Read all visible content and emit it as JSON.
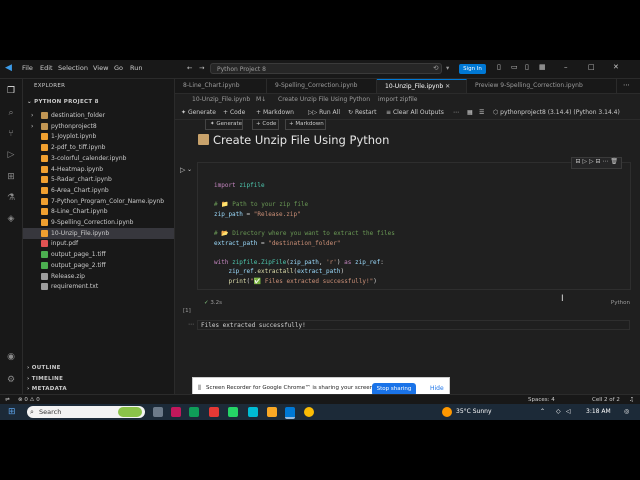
{
  "menu": [
    "File",
    "Edit",
    "Selection",
    "View",
    "Go",
    "Run"
  ],
  "title_search": "Python Project 8",
  "sign_in": "Sign In",
  "explorer": {
    "title": "EXPLORER",
    "project": "PYTHON PROJECT 8",
    "items": [
      {
        "label": "destination_folder",
        "kind": "folder"
      },
      {
        "label": "pythonproject8",
        "kind": "folder"
      },
      {
        "label": "1-Joyplot.ipynb",
        "kind": "nb"
      },
      {
        "label": "2-pdf_to_tiff.ipynb",
        "kind": "nb"
      },
      {
        "label": "3-colorful_calender.ipynb",
        "kind": "nb"
      },
      {
        "label": "4-Heatmap.ipynb",
        "kind": "nb"
      },
      {
        "label": "5-Radar_chart.ipynb",
        "kind": "nb"
      },
      {
        "label": "6-Area_Chart.ipynb",
        "kind": "nb"
      },
      {
        "label": "7-Python_Program_Color_Name.ipynb",
        "kind": "nb"
      },
      {
        "label": "8-Line_Chart.ipynb",
        "kind": "nb"
      },
      {
        "label": "9-Spelling_Correction.ipynb",
        "kind": "nb"
      },
      {
        "label": "10-Unzip_File.ipynb",
        "kind": "nb",
        "selected": true
      },
      {
        "label": "input.pdf",
        "kind": "pdf"
      },
      {
        "label": "output_page_1.tiff",
        "kind": "img"
      },
      {
        "label": "output_page_2.tiff",
        "kind": "img"
      },
      {
        "label": "Release.zip",
        "kind": "zip"
      },
      {
        "label": "requirement.txt",
        "kind": "txt"
      }
    ],
    "outline": "OUTLINE",
    "timeline": "TIMELINE",
    "metadata": "METADATA"
  },
  "tabs": [
    "8-Line_Chart.ipynb",
    "9-Spelling_Correction.ipynb",
    "10-Unzip_File.ipynb",
    "Preview 9-Spelling_Correction.ipynb"
  ],
  "breadcrumb": [
    "10-Unzip_File.ipynb",
    "M↓",
    "Create Unzip File Using Python",
    "import zipfile"
  ],
  "toolbar": {
    "generate": "Generate",
    "code": "Code",
    "markdown": "Markdown",
    "run_all": "Run All",
    "restart": "Restart",
    "clear": "Clear All Outputs",
    "kernel": "pythonproject8 (3.14.4) (Python 3.14.4)"
  },
  "mini_toolbar": {
    "generate": "Generate",
    "code": "Code",
    "markdown": "Markdown"
  },
  "heading": "Create Unzip File Using Python",
  "cell": {
    "exec_count": "[1]",
    "time": "3.2s",
    "lang": "Python",
    "code": [
      "import zipfile",
      "",
      "# 📁 Path to your zip file",
      "zip_path = \"Release.zip\"",
      "",
      "# 📂 Directory where you want to extract the files",
      "extract_path = \"destination_folder\"",
      "",
      "with zipfile.ZipFile(zip_path, 'r') as zip_ref:",
      "    zip_ref.extractall(extract_path)",
      "    print(\"✅ Files extracted successfully!\")"
    ]
  },
  "output": "Files extracted successfully!",
  "notice": {
    "text": "Screen Recorder for Google Chrome™ is sharing your screen.",
    "stop": "Stop sharing",
    "hide": "Hide"
  },
  "status": {
    "left": "⊗ 0 ⚠ 0",
    "spaces": "Spaces: 4",
    "cell": "Cell 2 of 2"
  },
  "taskbar": {
    "search": "Search",
    "weather": "35°C  Sunny",
    "time": "3:18 AM"
  }
}
